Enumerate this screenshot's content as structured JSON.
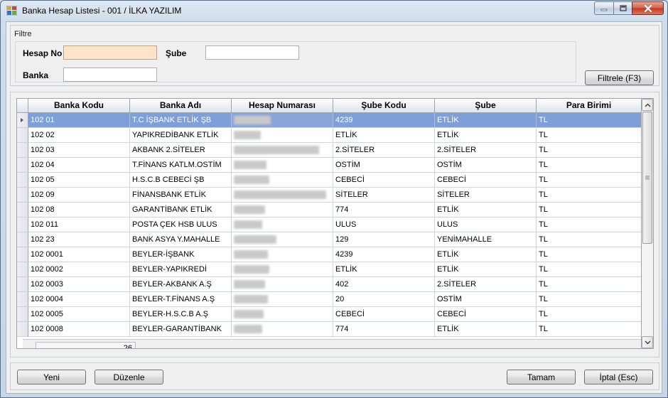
{
  "window": {
    "title": "Banka Hesap Listesi - 001 / İLKA YAZILIM",
    "icons": [
      "app-grid-icon",
      "minimize-icon",
      "maximize-icon",
      "close-icon"
    ]
  },
  "filter": {
    "group_label": "Filtre",
    "hesap_no_label": "Hesap No",
    "hesap_no_value": "",
    "sube_label": "Şube",
    "sube_value": "",
    "banka_label": "Banka",
    "banka_value": "",
    "filter_button": "Filtrele (F3)"
  },
  "grid": {
    "columns": [
      "Banka Kodu",
      "Banka Adı",
      "Hesap Numarası",
      "Şube Kodu",
      "Şube",
      "Para Birimi"
    ],
    "rows": [
      {
        "kod": "102 01",
        "ad": "T.C İŞBANK ETLİK ŞB",
        "sube_kodu": "4239",
        "sube": "ETLİK",
        "para": "TL"
      },
      {
        "kod": "102 02",
        "ad": "YAPIKREDİBANK ETLİK",
        "sube_kodu": "ETLİK",
        "sube": "ETLİK",
        "para": "TL"
      },
      {
        "kod": "102 03",
        "ad": "AKBANK 2.SİTELER",
        "sube_kodu": "2.SİTELER",
        "sube": "2.SİTELER",
        "para": "TL"
      },
      {
        "kod": "102 04",
        "ad": "T.FİNANS KATLM.OSTİM",
        "sube_kodu": "OSTİM",
        "sube": "OSTİM",
        "para": "TL"
      },
      {
        "kod": "102 05",
        "ad": "H.S.C.B CEBECİ ŞB",
        "sube_kodu": "CEBECİ",
        "sube": "CEBECİ",
        "para": "TL"
      },
      {
        "kod": "102 09",
        "ad": "FİNANSBANK ETLİK",
        "sube_kodu": "SİTELER",
        "sube": "SİTELER",
        "para": "TL"
      },
      {
        "kod": "102 08",
        "ad": "GARANTİBANK ETLİK",
        "sube_kodu": "774",
        "sube": "ETLİK",
        "para": "TL"
      },
      {
        "kod": "102 011",
        "ad": "POSTA ÇEK HSB ULUS",
        "sube_kodu": "ULUS",
        "sube": "ULUS",
        "para": "TL"
      },
      {
        "kod": "102 23",
        "ad": "BANK ASYA Y.MAHALLE",
        "sube_kodu": "129",
        "sube": "YENİMAHALLE",
        "para": "TL"
      },
      {
        "kod": "102 0001",
        "ad": "BEYLER-İŞBANK",
        "sube_kodu": "4239",
        "sube": "ETLİK",
        "para": "TL"
      },
      {
        "kod": "102 0002",
        "ad": "BEYLER-YAPIKREDİ",
        "sube_kodu": "ETLİK",
        "sube": "ETLİK",
        "para": "TL"
      },
      {
        "kod": "102 0003",
        "ad": "BEYLER-AKBANK A.Ş",
        "sube_kodu": "402",
        "sube": "2.SİTELER",
        "para": "TL"
      },
      {
        "kod": "102 0004",
        "ad": "BEYLER-T.FİNANS A.Ş",
        "sube_kodu": "20",
        "sube": "OSTİM",
        "para": "TL"
      },
      {
        "kod": "102 0005",
        "ad": "BEYLER-H.S.C.B A.Ş",
        "sube_kodu": "CEBECİ",
        "sube": "CEBECİ",
        "para": "TL"
      },
      {
        "kod": "102 0008",
        "ad": "BEYLER-GARANTİBANK",
        "sube_kodu": "774",
        "sube": "ETLİK",
        "para": "TL"
      }
    ],
    "record_count": "26"
  },
  "actions": {
    "yeni": "Yeni",
    "duzenle": "Düzenle",
    "tamam": "Tamam",
    "iptal": "İptal (Esc)"
  },
  "colors": {
    "selection": "#7e9fd8",
    "focused_field": "#fde3c9",
    "close_button": "#c8452e"
  }
}
